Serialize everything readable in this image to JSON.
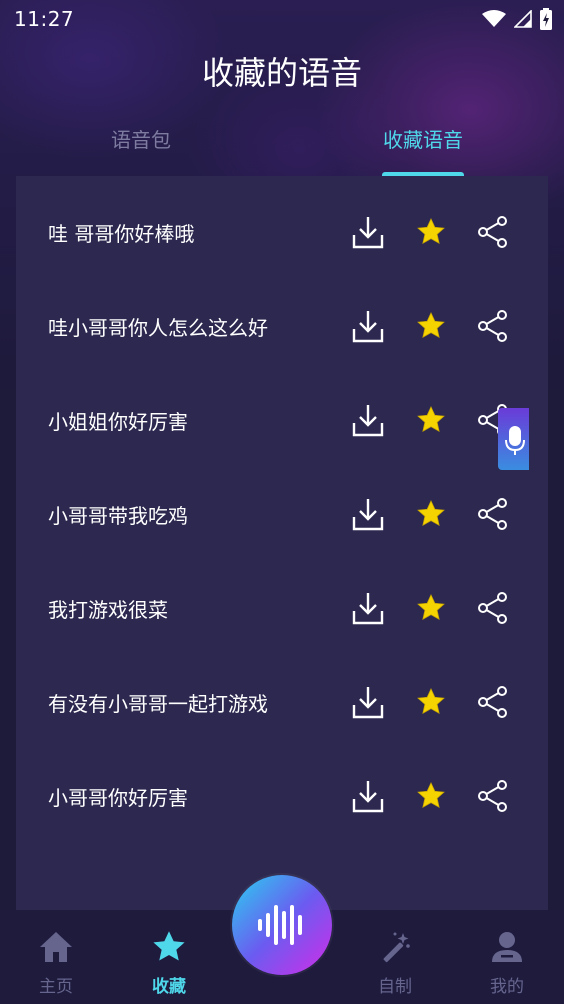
{
  "status_bar": {
    "time": "11:27",
    "icons": [
      "wifi-icon",
      "signal-icon",
      "battery-charging-icon"
    ]
  },
  "header": {
    "title": "收藏的语音"
  },
  "tabs": [
    {
      "label": "语音包",
      "active": false
    },
    {
      "label": "收藏语音",
      "active": true
    }
  ],
  "favorites": {
    "items": [
      {
        "label": "哇 哥哥你好棒哦"
      },
      {
        "label": "哇小哥哥你人怎么这么好"
      },
      {
        "label": "小姐姐你好厉害"
      },
      {
        "label": "小哥哥带我吃鸡"
      },
      {
        "label": "我打游戏很菜"
      },
      {
        "label": "有没有小哥哥一起打游戏"
      },
      {
        "label": "小哥哥你好厉害"
      }
    ],
    "actions": [
      "download-icon",
      "star-icon",
      "share-icon"
    ]
  },
  "bottom_nav": {
    "items": [
      {
        "label": "主页",
        "icon": "home-icon",
        "active": false
      },
      {
        "label": "收藏",
        "icon": "star-icon",
        "active": true
      },
      {
        "label": "自制",
        "icon": "magic-wand-icon",
        "active": false
      },
      {
        "label": "我的",
        "icon": "user-icon",
        "active": false
      }
    ],
    "center_button_icon": "sound-wave-icon"
  },
  "colors": {
    "accent": "#4fd7ea",
    "star": "#f5d300",
    "inactive": "#66658e",
    "panel": "#2c284f",
    "background": "#1d1a3a"
  }
}
